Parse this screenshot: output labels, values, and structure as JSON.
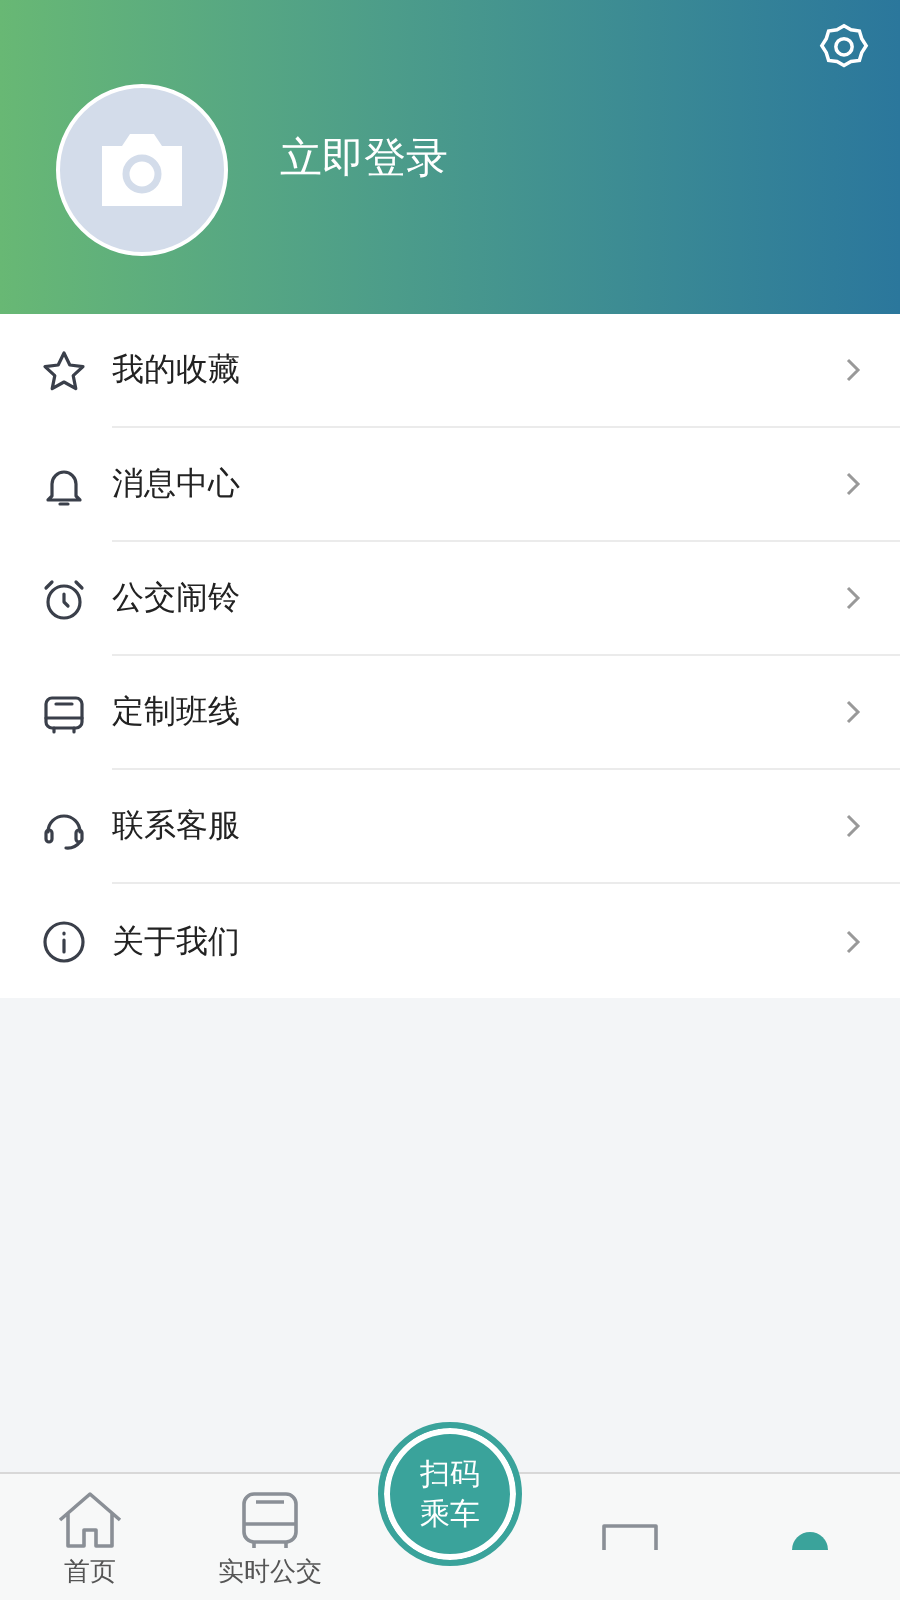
{
  "header": {
    "login_label": "立即登录"
  },
  "menu": [
    {
      "kind": "star",
      "label": "我的收藏"
    },
    {
      "kind": "bell",
      "label": "消息中心"
    },
    {
      "kind": "alarm",
      "label": "公交闹铃"
    },
    {
      "kind": "bus",
      "label": "定制班线"
    },
    {
      "kind": "headset",
      "label": "联系客服"
    },
    {
      "kind": "info",
      "label": "关于我们"
    }
  ],
  "tab_bar": {
    "tabs": [
      {
        "kind": "home",
        "label": "首页",
        "selected": false
      },
      {
        "kind": "bus",
        "label": "实时公交",
        "selected": false
      },
      {
        "kind": "scan",
        "label": "扫码乘车",
        "selected": false
      },
      {
        "kind": "box",
        "selected": false
      },
      {
        "kind": "dot",
        "selected": true
      }
    ]
  }
}
